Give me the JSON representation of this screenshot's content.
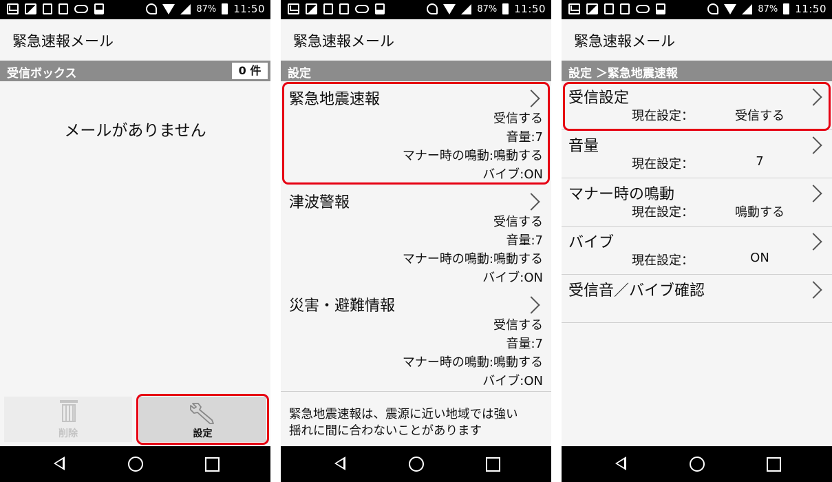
{
  "status_bar": {
    "battery": "87%",
    "time": "11:50"
  },
  "app_title": "緊急速報メール",
  "screen1": {
    "header": "受信ボックス",
    "count": "0 件",
    "empty_message": "メールがありません",
    "delete_label": "削除",
    "settings_label": "設定"
  },
  "screen2": {
    "header": "設定",
    "items": [
      {
        "title": "緊急地震速報",
        "receive": "受信する",
        "volume": "音量:7",
        "manner": "マナー時の鳴動:鳴動する",
        "vibe": "バイブ:ON"
      },
      {
        "title": "津波警報",
        "receive": "受信する",
        "volume": "音量:7",
        "manner": "マナー時の鳴動:鳴動する",
        "vibe": "バイブ:ON"
      },
      {
        "title": "災害・避難情報",
        "receive": "受信する",
        "volume": "音量:7",
        "manner": "マナー時の鳴動:鳴動する",
        "vibe": "バイブ:ON"
      }
    ],
    "note_line1": "緊急地震速報は、震源に近い地域では強い",
    "note_line2": "揺れに間に合わないことがあります"
  },
  "screen3": {
    "header": "設定 ＞緊急地震速報",
    "current_label": "現在設定：",
    "items": [
      {
        "title": "受信設定",
        "value": "受信する"
      },
      {
        "title": "音量",
        "value": "7"
      },
      {
        "title": "マナー時の鳴動",
        "value": "鳴動する"
      },
      {
        "title": "バイブ",
        "value": "ON"
      },
      {
        "title": "受信音／バイブ確認",
        "value": ""
      }
    ]
  },
  "colors": {
    "highlight": "#e60012",
    "header_bar": "#8c8c8c",
    "background": "#f5f5f5"
  }
}
